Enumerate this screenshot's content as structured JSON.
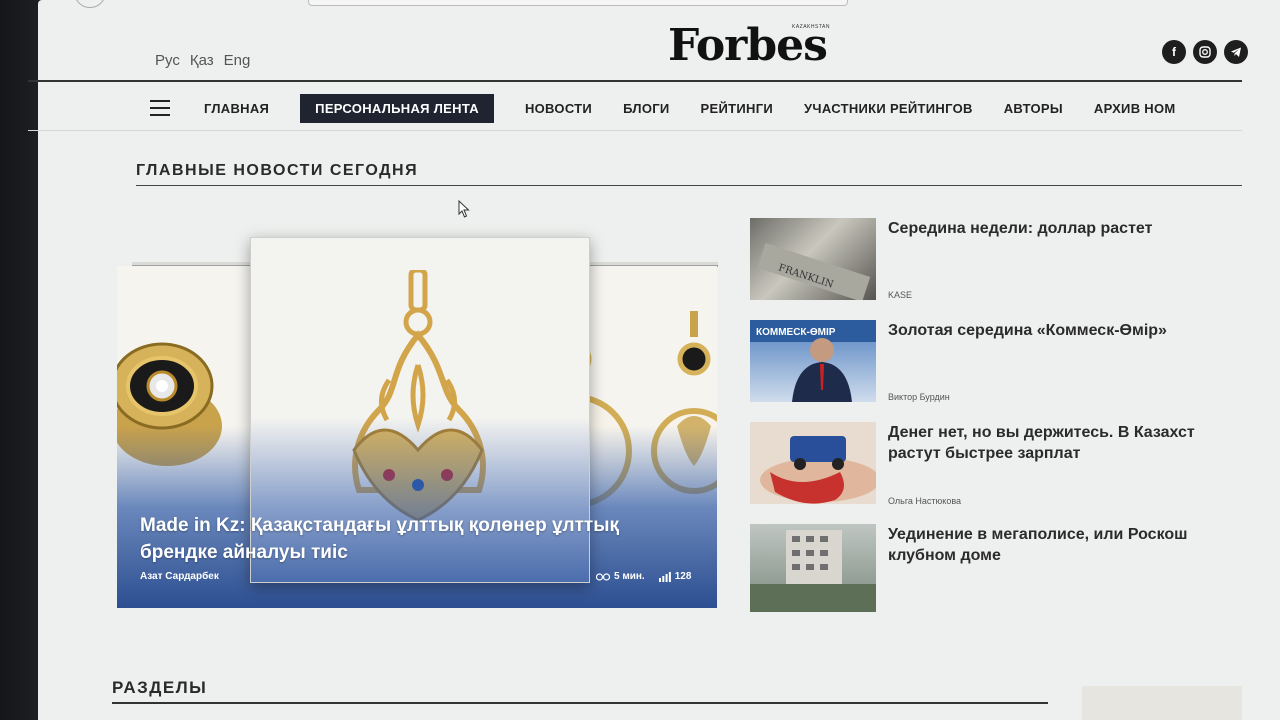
{
  "header": {
    "languages": [
      "Рус",
      "Қаз",
      "Eng"
    ],
    "logo": "Forbes",
    "logo_sub": "KAZAKHSTAN",
    "socials": [
      "facebook-icon",
      "instagram-icon",
      "telegram-icon"
    ]
  },
  "nav": {
    "items": [
      "ГЛАВНАЯ",
      "ПЕРСОНАЛЬНАЯ ЛЕНТА",
      "НОВОСТИ",
      "БЛОГИ",
      "РЕЙТИНГИ",
      "УЧАСТНИКИ РЕЙТИНГОВ",
      "АВТОРЫ",
      "АРХИВ НОМ"
    ],
    "active": "ПЕРСОНАЛЬНАЯ ЛЕНТА"
  },
  "top_news": {
    "section_title": "ГЛАВНЫЕ НОВОСТИ СЕГОДНЯ",
    "feature": {
      "title": "Made in Kz: Қазақстандағы ұлттық қолөнер ұлттық брендке айналуы тиіс",
      "author": "Азат Сардарбек",
      "read_time": "5 мин.",
      "views": "128"
    },
    "items": [
      {
        "title": "Середина недели: доллар растет",
        "author": "KASE"
      },
      {
        "title": "Золотая середина «Коммеск-Өмір»",
        "author": "Виктор Бурдин"
      },
      {
        "title": "Денег нет, но вы держитесь. В Казахст",
        "title2": "растут быстрее зарплат",
        "author": "Ольга Настюкова"
      },
      {
        "title": "Уединение в мегаполисе, или Роскош",
        "title2": "клубном доме",
        "author": ""
      }
    ]
  },
  "sections": {
    "title": "РАЗДЕЛЫ"
  },
  "colors": {
    "nav_active_bg": "#1f2430",
    "feature_overlay": "#2c5aa0"
  }
}
